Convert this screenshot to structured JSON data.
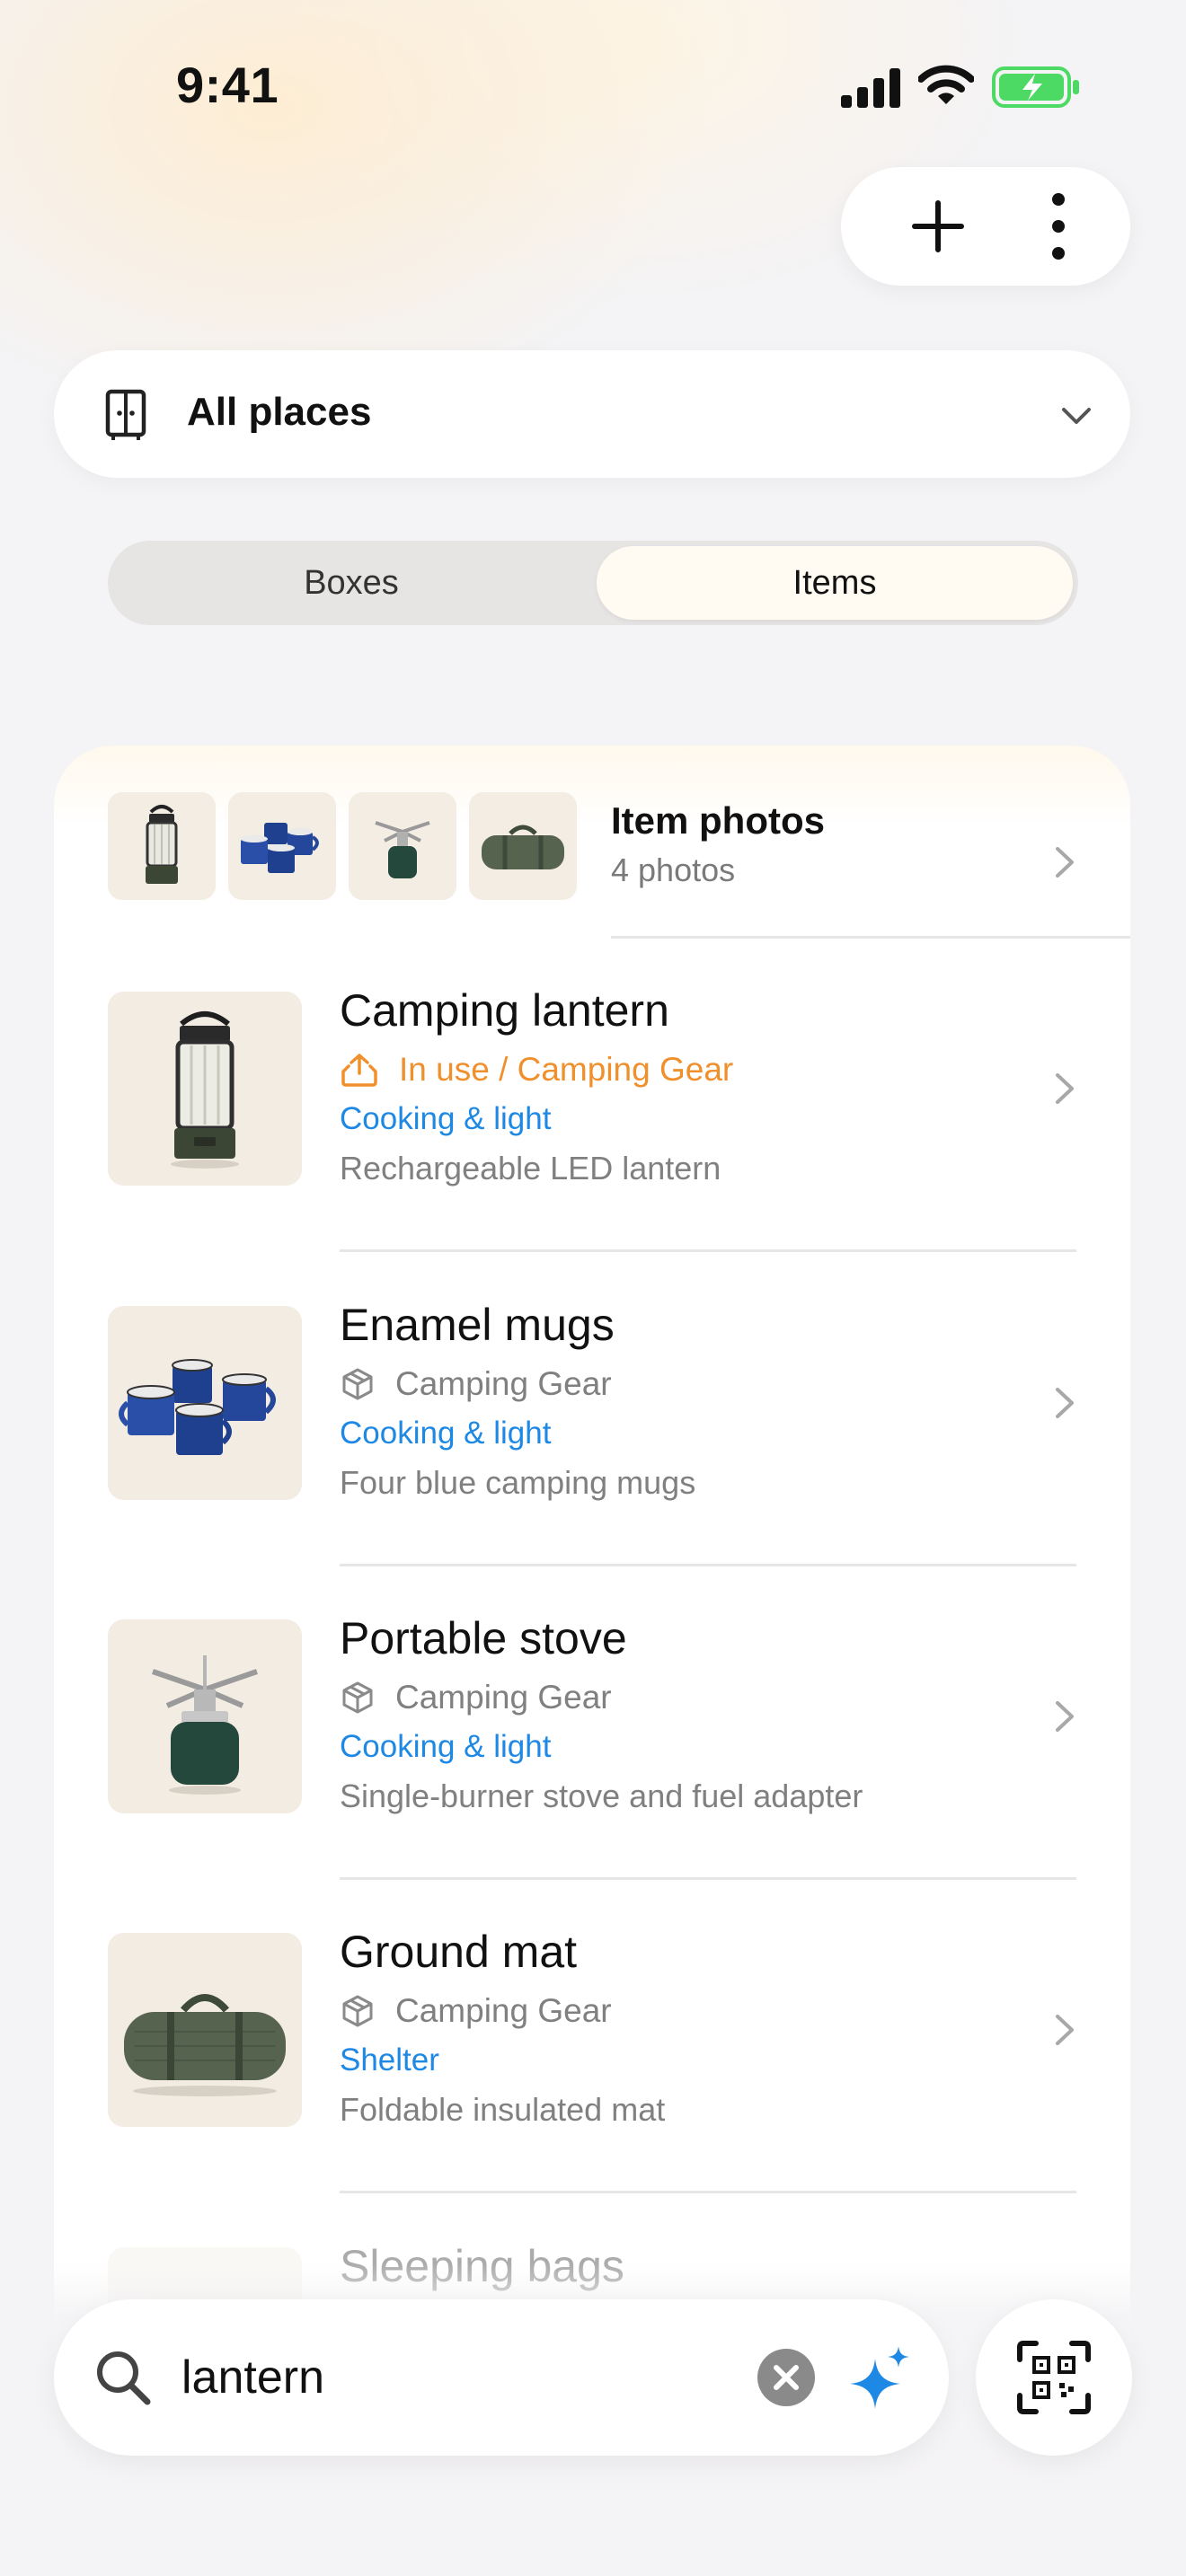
{
  "status_bar": {
    "time": "9:41"
  },
  "header": {
    "add_icon": "plus-icon",
    "more_icon": "vertical-ellipsis-icon"
  },
  "place_selector": {
    "label": "All places",
    "icon": "door-icon"
  },
  "segmented": {
    "options": [
      "Boxes",
      "Items"
    ],
    "selected": "Items"
  },
  "photos_summary": {
    "title": "Item photos",
    "count_text": "4 photos"
  },
  "items": [
    {
      "name": "Camping lantern",
      "location": "In use / Camping Gear",
      "location_status": "in-use",
      "tag": "Cooking & light",
      "description": "Rechargeable LED lantern"
    },
    {
      "name": "Enamel mugs",
      "location": "Camping Gear",
      "location_status": "box",
      "tag": "Cooking & light",
      "description": "Four blue camping mugs"
    },
    {
      "name": "Portable stove",
      "location": "Camping Gear",
      "location_status": "box",
      "tag": "Cooking & light",
      "description": "Single-burner stove and fuel adapter"
    },
    {
      "name": "Ground mat",
      "location": "Camping Gear",
      "location_status": "box",
      "tag": "Shelter",
      "description": "Foldable insulated mat"
    },
    {
      "name": "Sleeping bags"
    }
  ],
  "search": {
    "value": "lantern",
    "placeholder": ""
  },
  "colors": {
    "accent_blue": "#1e88e5",
    "in_use_orange": "#f0902c",
    "battery_green": "#4cd964"
  }
}
